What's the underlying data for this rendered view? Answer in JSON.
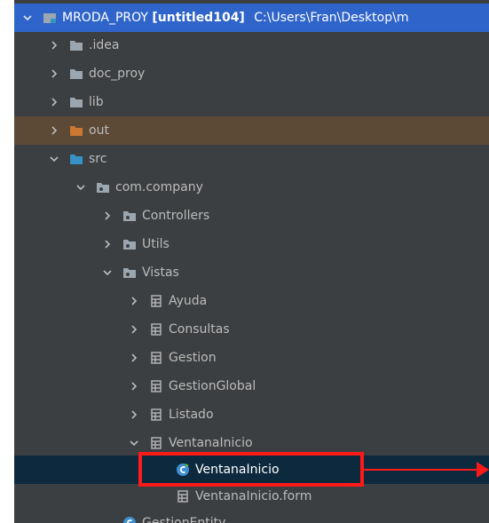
{
  "tree": {
    "root": {
      "name": "MRODA_PROY",
      "module": "[untitled104]",
      "path": "C:\\Users\\Fran\\Desktop\\m"
    },
    "items": [
      {
        "label": ".idea"
      },
      {
        "label": "doc_proy"
      },
      {
        "label": "lib"
      },
      {
        "label": "out"
      },
      {
        "label": "src"
      },
      {
        "label": "com.company"
      },
      {
        "label": "Controllers"
      },
      {
        "label": "Utils"
      },
      {
        "label": "Vistas"
      },
      {
        "label": "Ayuda"
      },
      {
        "label": "Consultas"
      },
      {
        "label": "Gestion"
      },
      {
        "label": "GestionGlobal"
      },
      {
        "label": "Listado"
      },
      {
        "label": "VentanaInicio"
      },
      {
        "label": "VentanaInicio"
      },
      {
        "label": "VentanaInicio.form"
      },
      {
        "label": "GestionEntity"
      }
    ]
  },
  "colors": {
    "panel_bg": "#3c3f41",
    "selection": "#2f65ca",
    "excluded_folder": "#cc7832",
    "folder": "#9aa7b0",
    "source_folder": "#3592c4",
    "annotation": "#ff1a1a"
  },
  "icons": {
    "expanded": "chevron-down-icon",
    "collapsed": "chevron-right-icon",
    "folder": "folder-icon",
    "source_root": "source-folder-icon",
    "package": "package-icon",
    "form": "form-icon",
    "class": "java-class-icon"
  }
}
